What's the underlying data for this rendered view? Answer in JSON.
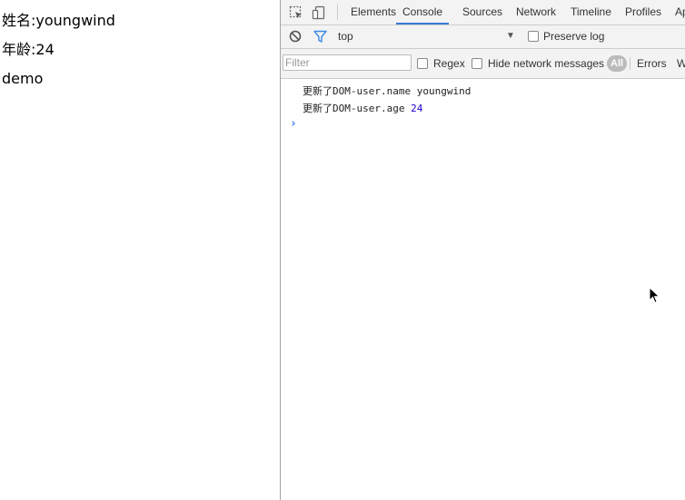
{
  "page": {
    "lines": [
      "姓名:youngwind",
      "年龄:24",
      "demo"
    ]
  },
  "devtools": {
    "tabs": [
      "Elements",
      "Console",
      "Sources",
      "Network",
      "Timeline",
      "Profiles",
      "Ap"
    ],
    "active_tab": "Console",
    "context": "top",
    "preserve_log_label": "Preserve log",
    "filter_placeholder": "Filter",
    "regex_label": "Regex",
    "hide_network_label": "Hide network messages",
    "level_all": "All",
    "level_errors": "Errors",
    "level_w": "W",
    "accent_color": "#3879d9",
    "console_messages": [
      {
        "text": "更新了DOM-user.name youngwind"
      },
      {
        "text": "更新了DOM-user.age ",
        "value": "24"
      }
    ]
  }
}
